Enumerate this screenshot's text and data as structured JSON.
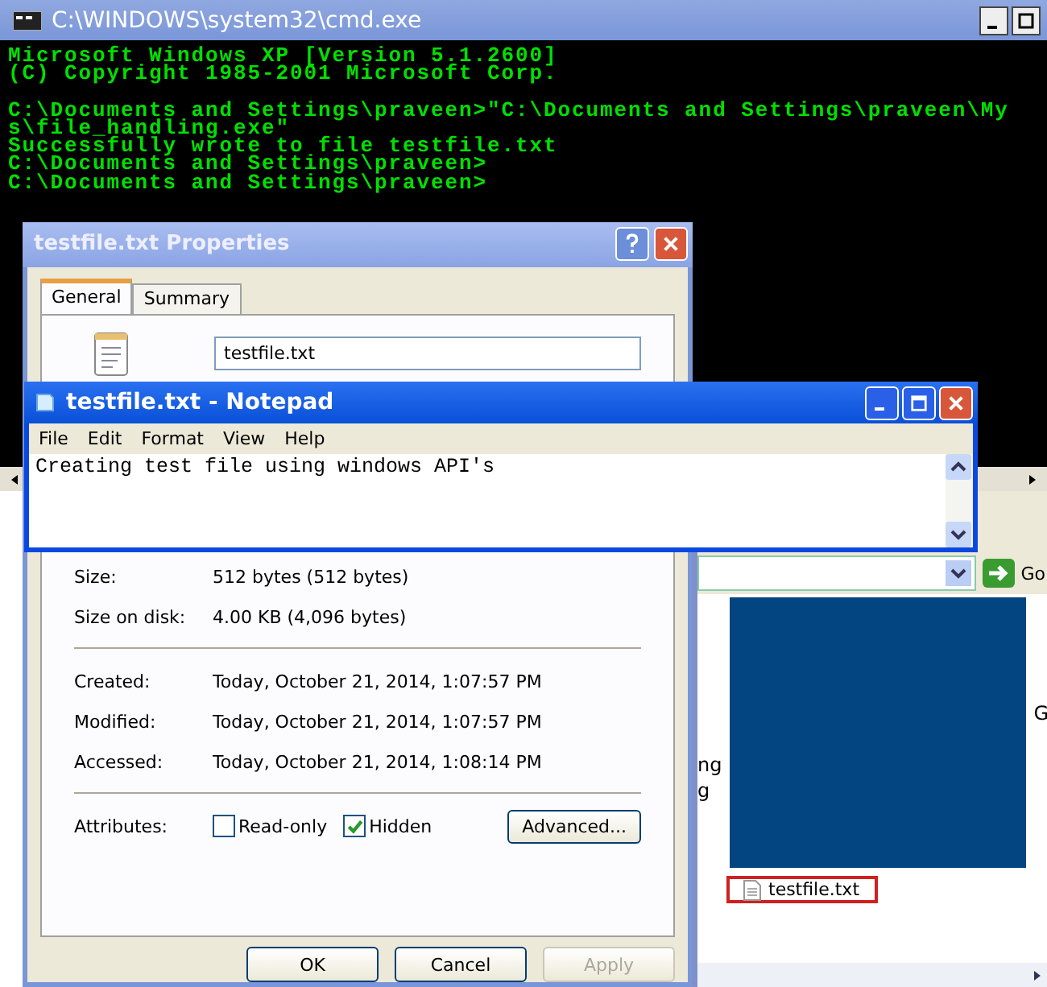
{
  "cmd": {
    "title": "C:\\WINDOWS\\system32\\cmd.exe",
    "blocks": [
      [
        "Microsoft Windows XP [Version 5.1.2600]",
        "(C) Copyright 1985-2001 Microsoft Corp."
      ],
      [
        "C:\\Documents and Settings\\praveen>\"C:\\Documents and Settings\\praveen\\My",
        "s\\file_handling.exe\"",
        "Successfully wrote to file testfile.txt",
        "C:\\Documents and Settings\\praveen>",
        "C:\\Documents and Settings\\praveen>"
      ]
    ]
  },
  "explorer": {
    "go": "Go",
    "left_fragments": [
      "ng",
      "g"
    ],
    "right_fragments": [
      "G"
    ],
    "file": {
      "name": "testfile.txt",
      "highlighted": true
    }
  },
  "properties": {
    "title": "testfile.txt Properties",
    "tabs": [
      {
        "label": "General",
        "selected": true
      },
      {
        "label": "Summary",
        "selected": false
      }
    ],
    "file_name": "testfile.txt",
    "groups": [
      [
        {
          "label": "Size:",
          "value": "512 bytes (512 bytes)"
        },
        {
          "label": "Size on disk:",
          "value": "4.00 KB (4,096 bytes)"
        }
      ],
      [
        {
          "label": "Created:",
          "value": "Today, October 21, 2014, 1:07:57 PM"
        },
        {
          "label": "Modified:",
          "value": "Today, October 21, 2014, 1:07:57 PM"
        },
        {
          "label": "Accessed:",
          "value": "Today, October 21, 2014, 1:08:14 PM"
        }
      ]
    ],
    "attributes_label": "Attributes:",
    "attributes": [
      {
        "label": "Read-only",
        "checked": false
      },
      {
        "label": "Hidden",
        "checked": true
      }
    ],
    "advanced": "Advanced...",
    "buttons": [
      {
        "label": "OK",
        "disabled": false
      },
      {
        "label": "Cancel",
        "disabled": false
      },
      {
        "label": "Apply",
        "disabled": true
      }
    ]
  },
  "notepad": {
    "title": "testfile.txt - Notepad",
    "menu": [
      "File",
      "Edit",
      "Format",
      "View",
      "Help"
    ],
    "text": "Creating test file using windows API's"
  }
}
